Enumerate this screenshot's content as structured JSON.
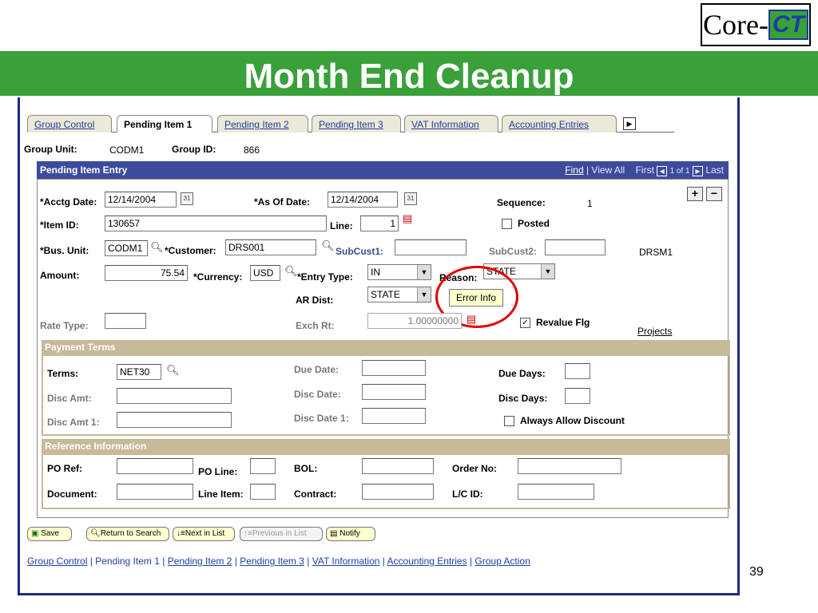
{
  "logo": {
    "core": "Core",
    "dash": "-",
    "ct": "CT"
  },
  "slide": {
    "title": "Month End Cleanup",
    "page_number": "39"
  },
  "tabs": [
    {
      "label": "Group Control"
    },
    {
      "label": "Pending Item 1"
    },
    {
      "label": "Pending Item 2"
    },
    {
      "label": "Pending Item 3"
    },
    {
      "label": "VAT Information"
    },
    {
      "label": "Accounting Entries"
    }
  ],
  "group": {
    "unit_label": "Group Unit:",
    "unit_value": "CODM1",
    "id_label": "Group ID:",
    "id_value": "866"
  },
  "entry": {
    "title": "Pending Item Entry",
    "find": "Find",
    "view_all": "View All",
    "first": "First",
    "count": "1 of 1",
    "last": "Last",
    "add": "+",
    "remove": "−"
  },
  "fields": {
    "acctg_date_label": "*Acctg Date:",
    "acctg_date": "12/14/2004",
    "as_of_date_label": "*As Of Date:",
    "as_of_date": "12/14/2004",
    "sequence_label": "Sequence:",
    "sequence": "1",
    "item_id_label": "*Item ID:",
    "item_id": "130657",
    "line_label": "Line:",
    "line": "1",
    "posted_label": "Posted",
    "bus_unit_label": "*Bus. Unit:",
    "bus_unit": "CODM1",
    "customer_label": "*Customer:",
    "customer": "DRS001",
    "subcust1_label": "SubCust1:",
    "subcust1": "",
    "subcust2_label": "SubCust2:",
    "subcust2": "",
    "drsm": "DRSM1",
    "amount_label": "Amount:",
    "amount": "75.54",
    "currency_label": "*Currency:",
    "currency": "USD",
    "entry_type_label": "*Entry Type:",
    "entry_type": "IN",
    "reason_label": "Reason:",
    "reason": "STATE",
    "ar_dist_label": "AR Dist:",
    "ar_dist": "STATE",
    "error_info": "Error Info",
    "rate_type_label": "Rate Type:",
    "rate_type": "",
    "exch_rt_label": "Exch Rt:",
    "exch_rt": "1.00000000",
    "revalue_label": "Revalue Flg",
    "projects": "Projects"
  },
  "payment_terms": {
    "title": "Payment Terms",
    "terms_label": "Terms:",
    "terms": "NET30",
    "due_date_label": "Due Date:",
    "due_date": "",
    "due_days_label": "Due Days:",
    "due_days": "",
    "disc_amt_label": "Disc Amt:",
    "disc_amt": "",
    "disc_date_label": "Disc Date:",
    "disc_date": "",
    "disc_days_label": "Disc Days:",
    "disc_days": "",
    "disc_amt1_label": "Disc Amt 1:",
    "disc_amt1": "",
    "disc_date1_label": "Disc Date 1:",
    "disc_date1": "",
    "always_allow_label": "Always Allow Discount"
  },
  "reference": {
    "title": "Reference Information",
    "po_ref_label": "PO Ref:",
    "po_line_label": "PO Line:",
    "bol_label": "BOL:",
    "order_no_label": "Order No:",
    "document_label": "Document:",
    "line_item_label": "Line Item:",
    "contract_label": "Contract:",
    "lc_id_label": "L/C ID:"
  },
  "toolbar": {
    "save": "Save",
    "return": "Return to Search",
    "next": "Next in List",
    "previous": "Previous in List",
    "notify": "Notify"
  },
  "footer_links": [
    "Group Control",
    "Pending Item 1",
    "Pending Item 2",
    "Pending Item 3",
    "VAT Information",
    "Accounting Entries",
    "Group Action"
  ],
  "colors": {
    "banner": "#3aa03a",
    "header_bar": "#3d4b9c",
    "section_bar": "#c8b998",
    "highlight_circle": "#e00000"
  }
}
